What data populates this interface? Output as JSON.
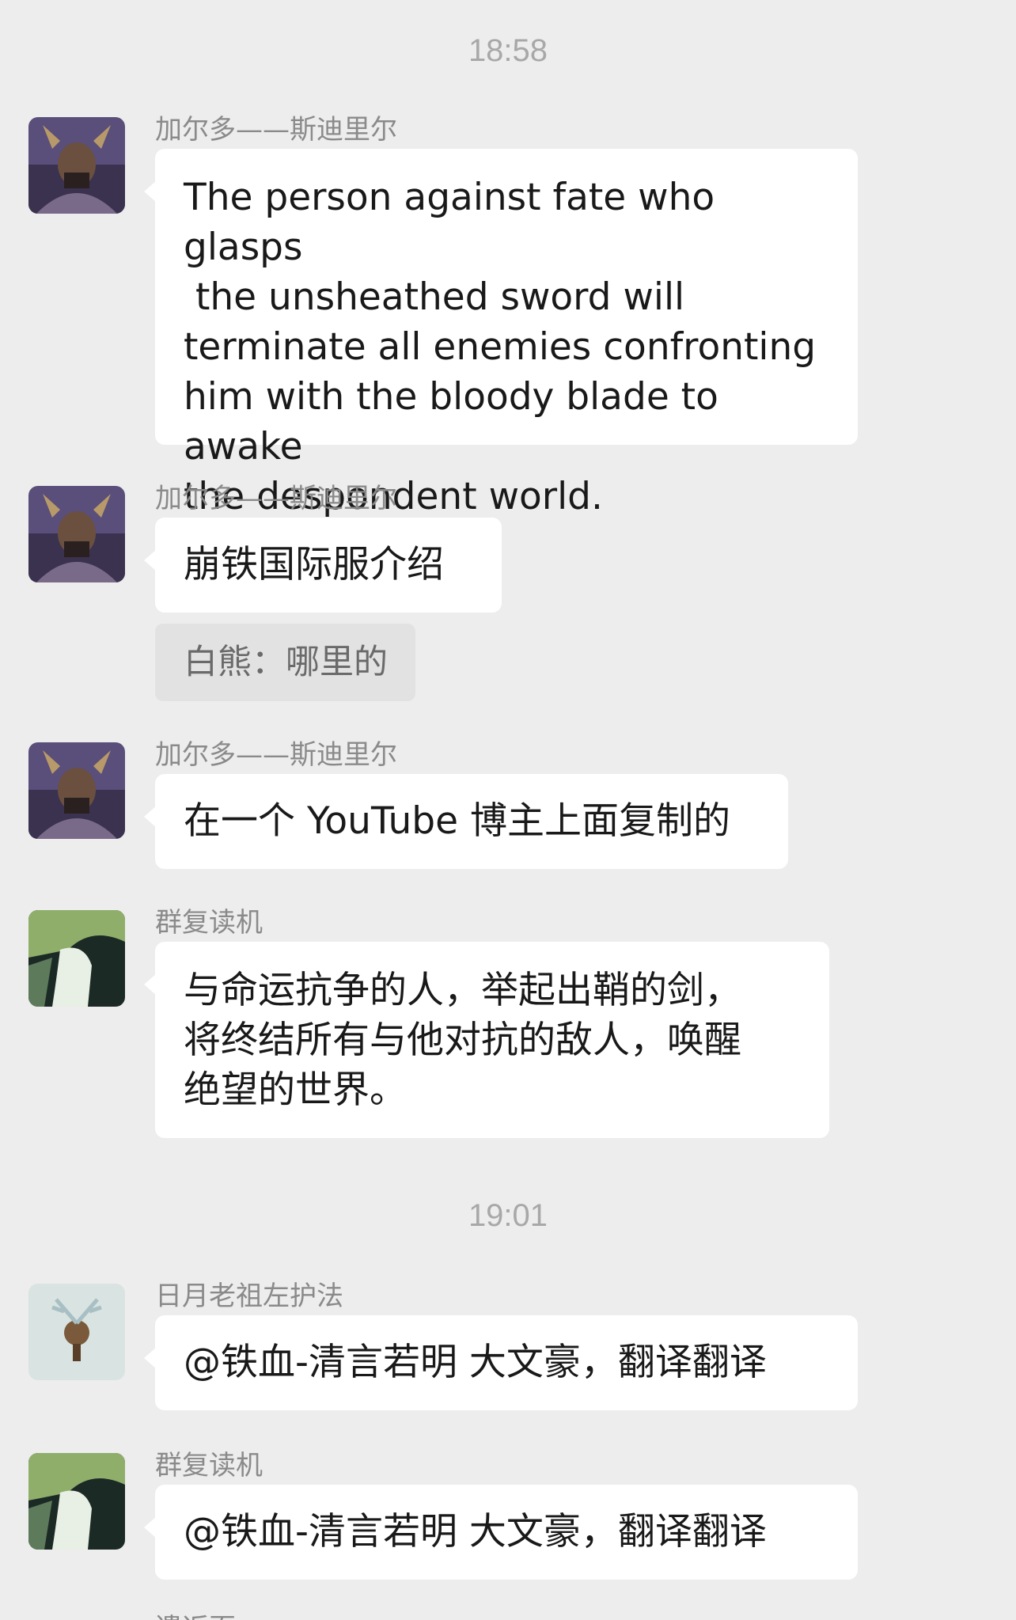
{
  "times": {
    "first": "18:58",
    "second": "19:01"
  },
  "messages": [
    {
      "sender": "加尔多——斯迪里尔",
      "avatar": "horned-warrior-avatar",
      "text": "The person against fate who glasps\n the unsheathed sword will\nterminate all enemies confronting\nhim with the bloody blade to awake\nthe despondent world."
    },
    {
      "sender": "加尔多——斯迪里尔",
      "avatar": "horned-warrior-avatar",
      "text": "崩铁国际服介绍",
      "quote": "白熊：哪里的"
    },
    {
      "sender": "加尔多——斯迪里尔",
      "avatar": "horned-warrior-avatar",
      "text": "在一个 YouTube 博主上面复制的"
    },
    {
      "sender": "群复读机",
      "avatar": "green-hair-profile-avatar",
      "text": "与命运抗争的人，举起出鞘的剑，\n将终结所有与他对抗的敌人，唤醒\n绝望的世界。"
    },
    {
      "sender": "日月老祖左护法",
      "avatar": "deer-avatar",
      "text": "@铁血-清言若明 大文豪，翻译翻译"
    },
    {
      "sender": "群复读机",
      "avatar": "green-hair-profile-avatar",
      "text": "@铁血-清言若明 大文豪，翻译翻译"
    }
  ],
  "cutoff_sender": "遗返页"
}
